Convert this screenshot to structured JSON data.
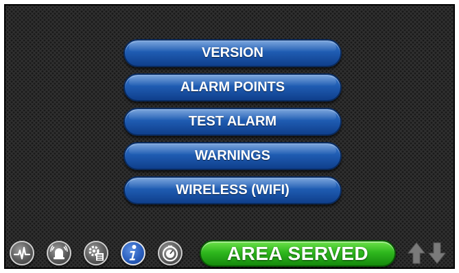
{
  "menu": {
    "items": [
      {
        "label": "VERSION"
      },
      {
        "label": "ALARM POINTS"
      },
      {
        "label": "TEST ALARM"
      },
      {
        "label": "WARNINGS"
      },
      {
        "label": "WIRELESS (WIFI)"
      }
    ]
  },
  "bottom_bar": {
    "icons": [
      {
        "name": "pulse-icon"
      },
      {
        "name": "alarm-bell-icon"
      },
      {
        "name": "settings-checklist-icon"
      },
      {
        "name": "info-icon",
        "active": true
      },
      {
        "name": "gauge-icon"
      }
    ],
    "area_served_label": "AREA SERVED",
    "arrows": [
      "up-arrow-icon",
      "down-arrow-icon"
    ]
  },
  "colors": {
    "menu_button": "#1f5cb2",
    "area_served_button": "#2fb81e",
    "active_icon": "#2a5fbf",
    "background": "#303030"
  }
}
